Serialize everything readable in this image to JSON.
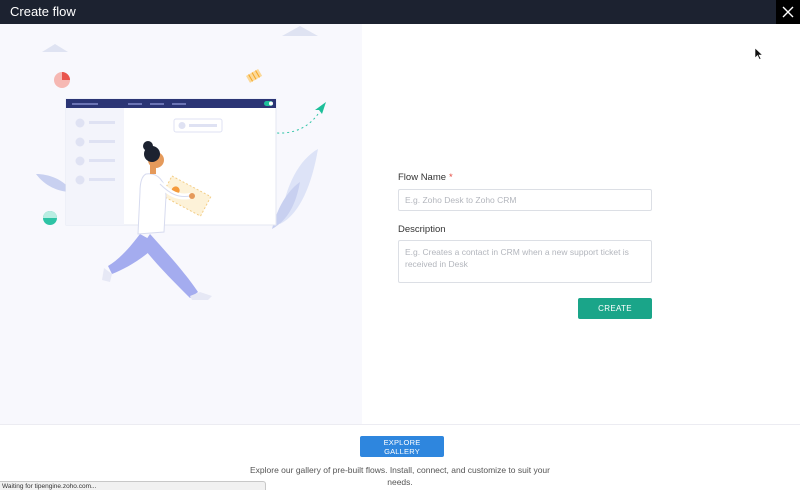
{
  "window": {
    "title": "Create flow"
  },
  "form": {
    "flow_name_label": "Flow Name",
    "required_marker": "*",
    "flow_name_placeholder": "E.g. Zoho Desk to Zoho CRM",
    "flow_name_value": "",
    "description_label": "Description",
    "description_placeholder": "E.g. Creates a contact in CRM when a new support ticket is received in Desk",
    "description_value": "",
    "create_button": "CREATE"
  },
  "footer": {
    "explore_button": "EXPLORE GALLERY",
    "text": "Explore our gallery of pre-built flows. Install, connect, and customize to suit your needs."
  },
  "status": {
    "text": "Waiting for tipengine.zoho.com..."
  },
  "colors": {
    "titlebar": "#1c2230",
    "create_button": "#1aa589",
    "explore_button": "#2e86de",
    "required": "#e5493f",
    "illustration_panel": "#f8f8fd"
  },
  "icons": [
    "close-icon",
    "mouse-cursor-icon"
  ]
}
